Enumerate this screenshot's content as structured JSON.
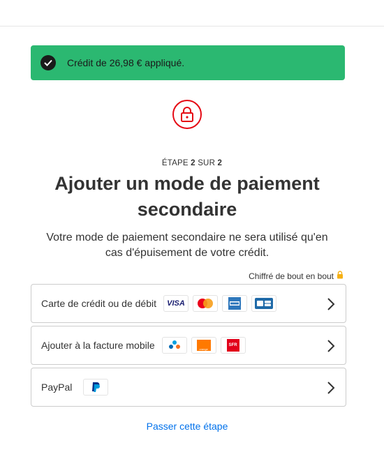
{
  "banner": {
    "message": "Crédit de 26,98 € appliqué."
  },
  "step": {
    "prefix": "ÉTAPE",
    "current": "2",
    "separator": "SUR",
    "total": "2"
  },
  "title": "Ajouter un mode de paiement secondaire",
  "subtitle": "Votre mode de paiement secondaire ne sera utilisé qu'en cas d'épuisement de votre crédit.",
  "secure_note": "Chiffré de bout en bout",
  "options": [
    {
      "label": "Carte de crédit ou de débit",
      "logos": [
        "visa-logo",
        "mastercard-logo",
        "amex-logo",
        "cb-logo"
      ]
    },
    {
      "label": "Ajouter à la facture mobile",
      "logos": [
        "bouygues-logo",
        "orange-logo",
        "sfr-logo"
      ]
    },
    {
      "label": "PayPal",
      "logos": [
        "paypal-logo"
      ]
    }
  ],
  "logo_text": {
    "visa": "VISA",
    "sfr": "SFR",
    "orange": "orange"
  },
  "skip_link": "Passer cette étape",
  "colors": {
    "success": "#2bb871",
    "brand_red": "#e50914",
    "link": "#0071eb",
    "lock_gold": "#f5b014"
  }
}
